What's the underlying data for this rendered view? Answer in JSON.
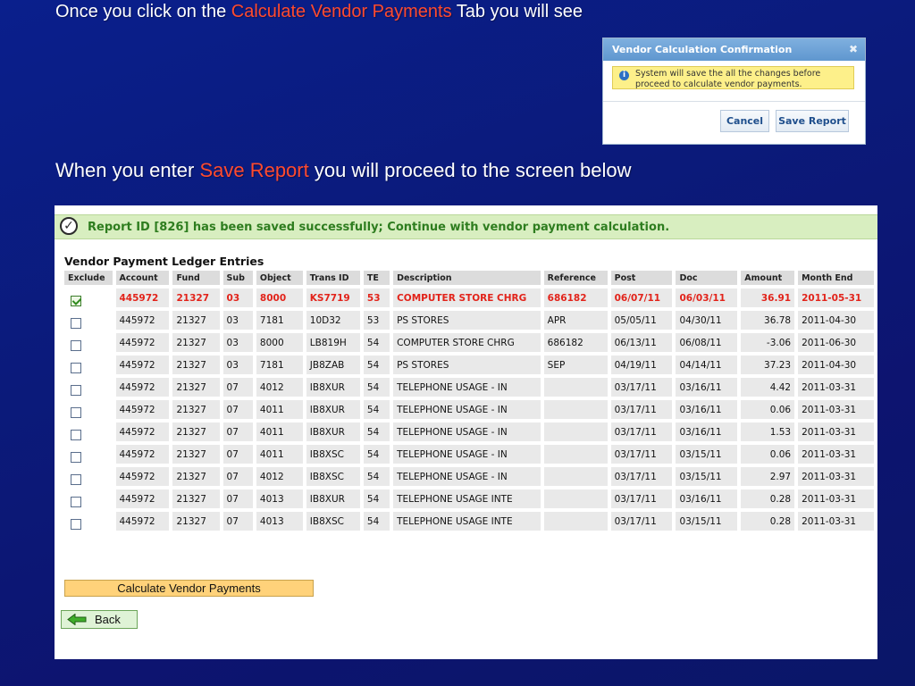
{
  "slide": {
    "line1_pre": "Once you click on the ",
    "line1_accent": "Calculate Vendor Payments",
    "line1_post": " Tab you will see",
    "line2_pre": "When you enter ",
    "line2_accent": "Save Report",
    "line2_post": " you will proceed to the  screen below",
    "accent_color": "#ff4a2e"
  },
  "dialog": {
    "title": "Vendor Calculation Confirmation",
    "close_icon": "close-icon",
    "message_line1": "System will save the all the changes before",
    "message_line2": "proceed to calculate vendor payments.",
    "cancel_label": "Cancel",
    "save_label": "Save Report"
  },
  "panel": {
    "success_message": "Report ID [826] has been saved successfully; Continue with vendor payment calculation.",
    "section_title": "Vendor Payment Ledger Entries",
    "columns": [
      "Exclude",
      "Account",
      "Fund",
      "Sub",
      "Object",
      "Trans ID",
      "TE",
      "Description",
      "Reference",
      "Post",
      "Doc",
      "Amount",
      "Month End"
    ],
    "rows": [
      {
        "excluded": true,
        "account": "445972",
        "fund": "21327",
        "sub": "03",
        "object": "8000",
        "trans_id": "KS7719",
        "te": "53",
        "description": "COMPUTER STORE CHRG",
        "reference": "686182",
        "post": "06/07/11",
        "doc": "06/03/11",
        "amount": "36.91",
        "month_end": "2011-05-31"
      },
      {
        "excluded": false,
        "account": "445972",
        "fund": "21327",
        "sub": "03",
        "object": "7181",
        "trans_id": "10D32",
        "te": "53",
        "description": "PS STORES",
        "reference": "APR",
        "post": "05/05/11",
        "doc": "04/30/11",
        "amount": "36.78",
        "month_end": "2011-04-30"
      },
      {
        "excluded": false,
        "account": "445972",
        "fund": "21327",
        "sub": "03",
        "object": "8000",
        "trans_id": "LB819H",
        "te": "54",
        "description": "COMPUTER STORE CHRG",
        "reference": "686182",
        "post": "06/13/11",
        "doc": "06/08/11",
        "amount": "-3.06",
        "month_end": "2011-06-30"
      },
      {
        "excluded": false,
        "account": "445972",
        "fund": "21327",
        "sub": "03",
        "object": "7181",
        "trans_id": "JB8ZAB",
        "te": "54",
        "description": "PS STORES",
        "reference": "SEP",
        "post": "04/19/11",
        "doc": "04/14/11",
        "amount": "37.23",
        "month_end": "2011-04-30"
      },
      {
        "excluded": false,
        "account": "445972",
        "fund": "21327",
        "sub": "07",
        "object": "4012",
        "trans_id": "IB8XUR",
        "te": "54",
        "description": "TELEPHONE USAGE - IN",
        "reference": "",
        "post": "03/17/11",
        "doc": "03/16/11",
        "amount": "4.42",
        "month_end": "2011-03-31"
      },
      {
        "excluded": false,
        "account": "445972",
        "fund": "21327",
        "sub": "07",
        "object": "4011",
        "trans_id": "IB8XUR",
        "te": "54",
        "description": "TELEPHONE USAGE - IN",
        "reference": "",
        "post": "03/17/11",
        "doc": "03/16/11",
        "amount": "0.06",
        "month_end": "2011-03-31"
      },
      {
        "excluded": false,
        "account": "445972",
        "fund": "21327",
        "sub": "07",
        "object": "4011",
        "trans_id": "IB8XUR",
        "te": "54",
        "description": "TELEPHONE USAGE - IN",
        "reference": "",
        "post": "03/17/11",
        "doc": "03/16/11",
        "amount": "1.53",
        "month_end": "2011-03-31"
      },
      {
        "excluded": false,
        "account": "445972",
        "fund": "21327",
        "sub": "07",
        "object": "4011",
        "trans_id": "IB8XSC",
        "te": "54",
        "description": "TELEPHONE USAGE - IN",
        "reference": "",
        "post": "03/17/11",
        "doc": "03/15/11",
        "amount": "0.06",
        "month_end": "2011-03-31"
      },
      {
        "excluded": false,
        "account": "445972",
        "fund": "21327",
        "sub": "07",
        "object": "4012",
        "trans_id": "IB8XSC",
        "te": "54",
        "description": "TELEPHONE USAGE - IN",
        "reference": "",
        "post": "03/17/11",
        "doc": "03/15/11",
        "amount": "2.97",
        "month_end": "2011-03-31"
      },
      {
        "excluded": false,
        "account": "445972",
        "fund": "21327",
        "sub": "07",
        "object": "4013",
        "trans_id": "IB8XUR",
        "te": "54",
        "description": "TELEPHONE USAGE INTE",
        "reference": "",
        "post": "03/17/11",
        "doc": "03/16/11",
        "amount": "0.28",
        "month_end": "2011-03-31"
      },
      {
        "excluded": false,
        "account": "445972",
        "fund": "21327",
        "sub": "07",
        "object": "4013",
        "trans_id": "IB8XSC",
        "te": "54",
        "description": "TELEPHONE USAGE INTE",
        "reference": "",
        "post": "03/17/11",
        "doc": "03/15/11",
        "amount": "0.28",
        "month_end": "2011-03-31"
      }
    ],
    "calculate_label": "Calculate Vendor Payments",
    "back_label": "Back",
    "excluded_color": "#e2231a",
    "success_color": "#2e7d1f"
  }
}
